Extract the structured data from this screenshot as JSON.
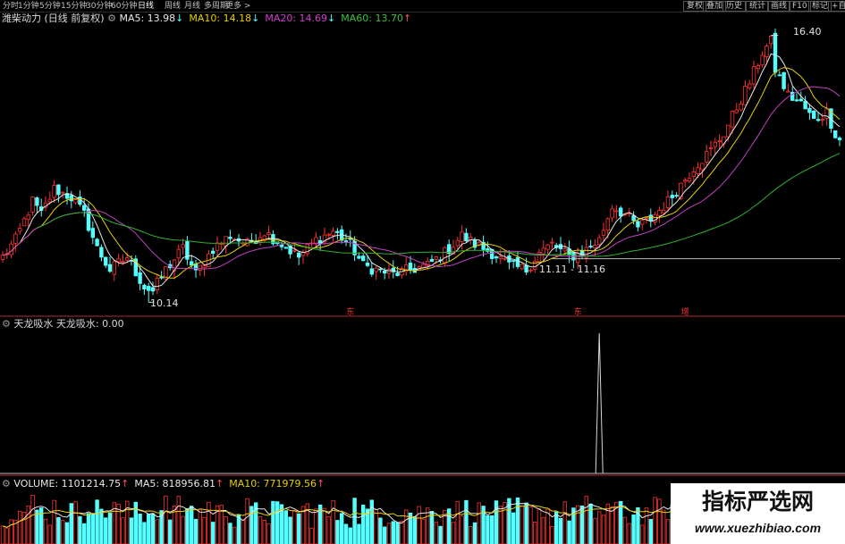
{
  "toolbar": {
    "timeframes": [
      "分时",
      "1分钟",
      "5分钟",
      "15分钟",
      "30分钟",
      "60分钟",
      "日线",
      "周线",
      "月线",
      "多周期",
      "更多 >"
    ],
    "active": "日线",
    "right_buttons": [
      "复权",
      "叠加",
      "历史",
      "统计",
      "画线",
      "F10",
      "标记",
      "+自选"
    ]
  },
  "main_panel": {
    "title": "潍柴动力 (日线 前复权)",
    "indicators": [
      {
        "label": "MA5: 13.98",
        "arrow": "↓",
        "color": "#e8e8e8"
      },
      {
        "label": "MA10: 14.18",
        "arrow": "↓",
        "color": "#e8d000"
      },
      {
        "label": "MA20: 14.69",
        "arrow": "↓",
        "color": "#d040d0"
      },
      {
        "label": "MA60: 13.70",
        "arrow": "↑",
        "color": "#40c040"
      }
    ],
    "high_label": "16.40",
    "low_label": "10.14",
    "range_label": "11.11 - 11.16",
    "markers": [
      {
        "text": "东",
        "index": 81
      },
      {
        "text": "东",
        "index": 134
      },
      {
        "text": "增",
        "index": 159
      }
    ]
  },
  "sub_panel": {
    "title": "天龙吸水",
    "indicator": "天龙吸水: 0.00",
    "spike_index": 139
  },
  "volume_panel": {
    "indicators": [
      {
        "label": "VOLUME: 1101214.75",
        "arrow": "↑",
        "color": "#e8e8e8"
      },
      {
        "label": "MA5: 818956.81",
        "arrow": "↑",
        "color": "#e8e8e8"
      },
      {
        "label": "MA10: 771979.56",
        "arrow": "↑",
        "color": "#e8d000"
      }
    ]
  },
  "colors": {
    "up": "#ff3232",
    "down": "#54ffff",
    "ma5": "#e8e8e8",
    "ma10": "#e8d000",
    "ma20": "#c040c0",
    "ma60": "#30b030"
  },
  "chart_data": {
    "type": "candlestick",
    "close_anchors": [
      [
        0,
        11.2
      ],
      [
        3,
        11.6
      ],
      [
        7,
        12.5
      ],
      [
        9,
        12.2
      ],
      [
        12,
        12.8
      ],
      [
        16,
        12.6
      ],
      [
        19,
        12.2
      ],
      [
        22,
        11.4
      ],
      [
        25,
        10.9
      ],
      [
        29,
        11.2
      ],
      [
        33,
        10.5
      ],
      [
        35,
        10.4
      ],
      [
        38,
        10.9
      ],
      [
        42,
        11.4
      ],
      [
        45,
        10.8
      ],
      [
        49,
        11.4
      ],
      [
        53,
        11.7
      ],
      [
        57,
        11.5
      ],
      [
        61,
        11.8
      ],
      [
        65,
        11.5
      ],
      [
        69,
        11.2
      ],
      [
        73,
        11.6
      ],
      [
        77,
        11.8
      ],
      [
        81,
        11.5
      ],
      [
        84,
        11.0
      ],
      [
        87,
        10.9
      ],
      [
        91,
        10.8
      ],
      [
        95,
        10.9
      ],
      [
        99,
        11.0
      ],
      [
        103,
        11.3
      ],
      [
        107,
        11.7
      ],
      [
        110,
        11.5
      ],
      [
        114,
        11.3
      ],
      [
        118,
        11.0
      ],
      [
        122,
        10.9
      ],
      [
        125,
        11.3
      ],
      [
        128,
        11.5
      ],
      [
        132,
        11.2
      ],
      [
        135,
        11.3
      ],
      [
        139,
        11.6
      ],
      [
        142,
        12.4
      ],
      [
        145,
        12.2
      ],
      [
        148,
        11.9
      ],
      [
        151,
        12.1
      ],
      [
        155,
        12.5
      ],
      [
        158,
        12.9
      ],
      [
        161,
        13.3
      ],
      [
        165,
        13.7
      ],
      [
        168,
        14.1
      ],
      [
        171,
        14.7
      ],
      [
        174,
        15.3
      ],
      [
        177,
        16.0
      ],
      [
        179,
        16.25
      ],
      [
        180,
        15.6
      ],
      [
        183,
        15.0
      ],
      [
        186,
        14.8
      ],
      [
        189,
        14.4
      ],
      [
        192,
        14.6
      ],
      [
        194,
        14.1
      ],
      [
        195,
        13.95
      ]
    ],
    "y_labels": {
      "high": 16.4,
      "low": 10.14,
      "range": [
        11.11,
        11.16
      ]
    }
  }
}
